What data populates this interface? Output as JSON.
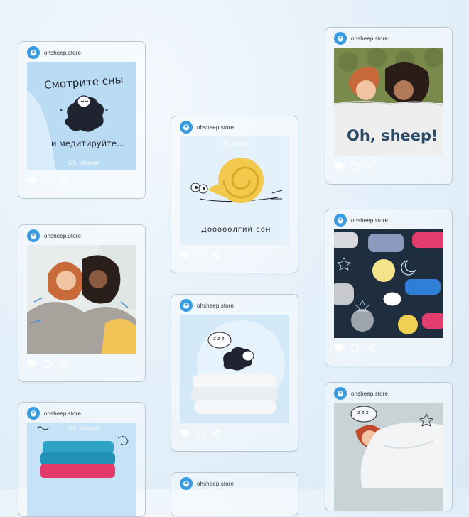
{
  "colors": {
    "accent": "#3a9ce0",
    "background": "#e6f1fa",
    "card_border": "#b9c6d3"
  },
  "icons": {
    "like": "heart-icon",
    "comment": "comment-icon",
    "share": "send-icon",
    "avatar": "sheep-logo-icon"
  },
  "posts": [
    {
      "username": "ohsheep.store",
      "line1": "Смотрите сны",
      "line2": "и медитируйте...",
      "watermark": "Oh, sheep!"
    },
    {
      "username": "ohsheep.store"
    },
    {
      "username": "ohsheep.store",
      "watermark": "Oh, sheep!"
    },
    {
      "username": "ohsheep.store",
      "watermark": "Oh, sheep!",
      "caption": "Дooooолгий сон"
    },
    {
      "username": "ohsheep.store",
      "sleep_text": "z z z"
    },
    {
      "username": "ohsheep.store"
    },
    {
      "username": "ohsheep.store",
      "brand": "Oh, sheep!"
    },
    {
      "username": "ohsheep.store"
    },
    {
      "username": "ohsheep.store",
      "sleep_text": "z z z"
    }
  ]
}
